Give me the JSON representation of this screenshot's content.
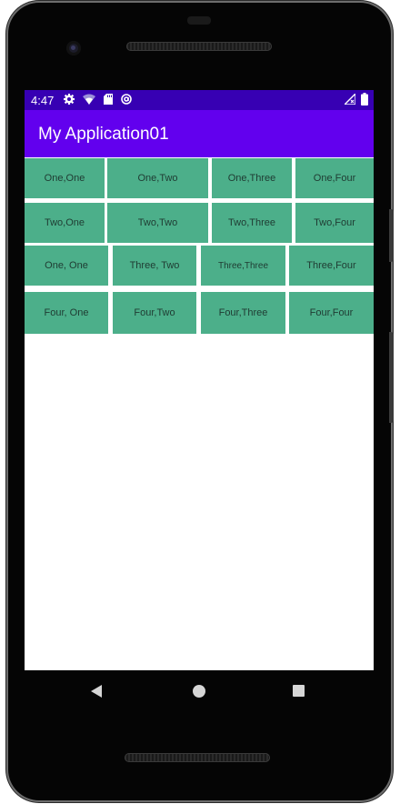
{
  "status_bar": {
    "time": "4:47",
    "left_icons": [
      "gear-icon",
      "wifi-icon",
      "sd-card-icon",
      "at-sign-icon"
    ],
    "right_icons": [
      "signal-icon",
      "battery-icon"
    ]
  },
  "app_bar": {
    "title": "My Application01"
  },
  "grid": {
    "rows": [
      [
        "One,One",
        "One,Two",
        "One,Three",
        "One,Four"
      ],
      [
        "Two,One",
        "Two,Two",
        "Two,Three",
        "Two,Four"
      ],
      [
        "One, One",
        "Three, Two",
        "Three,Three",
        "Three,Four"
      ],
      [
        "Four, One",
        "Four,Two",
        "Four,Three",
        "Four,Four"
      ]
    ]
  },
  "colors": {
    "status_bar": "#3700b3",
    "app_bar": "#6200ee",
    "cell": "#4caf8a"
  },
  "nav_bar": {
    "buttons": [
      "back-icon",
      "home-icon",
      "recents-icon"
    ]
  }
}
